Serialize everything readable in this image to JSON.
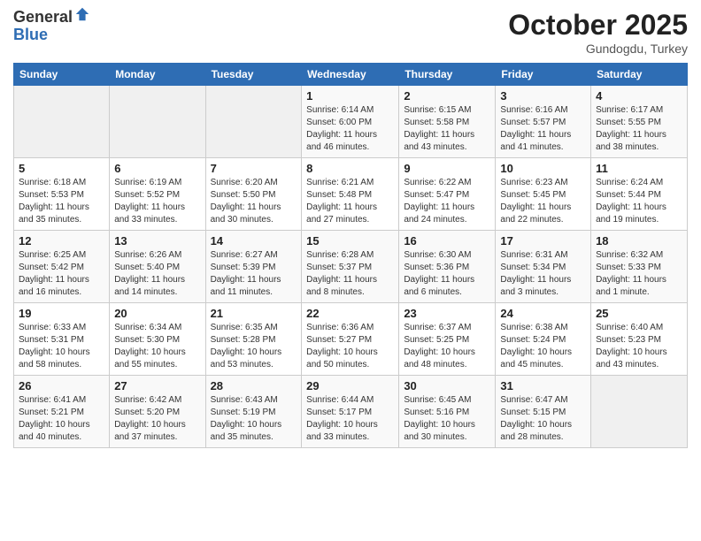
{
  "header": {
    "logo_line1": "General",
    "logo_line2": "Blue",
    "month": "October 2025",
    "location": "Gundogdu, Turkey"
  },
  "weekdays": [
    "Sunday",
    "Monday",
    "Tuesday",
    "Wednesday",
    "Thursday",
    "Friday",
    "Saturday"
  ],
  "weeks": [
    [
      {
        "day": "",
        "info": ""
      },
      {
        "day": "",
        "info": ""
      },
      {
        "day": "",
        "info": ""
      },
      {
        "day": "1",
        "info": "Sunrise: 6:14 AM\nSunset: 6:00 PM\nDaylight: 11 hours\nand 46 minutes."
      },
      {
        "day": "2",
        "info": "Sunrise: 6:15 AM\nSunset: 5:58 PM\nDaylight: 11 hours\nand 43 minutes."
      },
      {
        "day": "3",
        "info": "Sunrise: 6:16 AM\nSunset: 5:57 PM\nDaylight: 11 hours\nand 41 minutes."
      },
      {
        "day": "4",
        "info": "Sunrise: 6:17 AM\nSunset: 5:55 PM\nDaylight: 11 hours\nand 38 minutes."
      }
    ],
    [
      {
        "day": "5",
        "info": "Sunrise: 6:18 AM\nSunset: 5:53 PM\nDaylight: 11 hours\nand 35 minutes."
      },
      {
        "day": "6",
        "info": "Sunrise: 6:19 AM\nSunset: 5:52 PM\nDaylight: 11 hours\nand 33 minutes."
      },
      {
        "day": "7",
        "info": "Sunrise: 6:20 AM\nSunset: 5:50 PM\nDaylight: 11 hours\nand 30 minutes."
      },
      {
        "day": "8",
        "info": "Sunrise: 6:21 AM\nSunset: 5:48 PM\nDaylight: 11 hours\nand 27 minutes."
      },
      {
        "day": "9",
        "info": "Sunrise: 6:22 AM\nSunset: 5:47 PM\nDaylight: 11 hours\nand 24 minutes."
      },
      {
        "day": "10",
        "info": "Sunrise: 6:23 AM\nSunset: 5:45 PM\nDaylight: 11 hours\nand 22 minutes."
      },
      {
        "day": "11",
        "info": "Sunrise: 6:24 AM\nSunset: 5:44 PM\nDaylight: 11 hours\nand 19 minutes."
      }
    ],
    [
      {
        "day": "12",
        "info": "Sunrise: 6:25 AM\nSunset: 5:42 PM\nDaylight: 11 hours\nand 16 minutes."
      },
      {
        "day": "13",
        "info": "Sunrise: 6:26 AM\nSunset: 5:40 PM\nDaylight: 11 hours\nand 14 minutes."
      },
      {
        "day": "14",
        "info": "Sunrise: 6:27 AM\nSunset: 5:39 PM\nDaylight: 11 hours\nand 11 minutes."
      },
      {
        "day": "15",
        "info": "Sunrise: 6:28 AM\nSunset: 5:37 PM\nDaylight: 11 hours\nand 8 minutes."
      },
      {
        "day": "16",
        "info": "Sunrise: 6:30 AM\nSunset: 5:36 PM\nDaylight: 11 hours\nand 6 minutes."
      },
      {
        "day": "17",
        "info": "Sunrise: 6:31 AM\nSunset: 5:34 PM\nDaylight: 11 hours\nand 3 minutes."
      },
      {
        "day": "18",
        "info": "Sunrise: 6:32 AM\nSunset: 5:33 PM\nDaylight: 11 hours\nand 1 minute."
      }
    ],
    [
      {
        "day": "19",
        "info": "Sunrise: 6:33 AM\nSunset: 5:31 PM\nDaylight: 10 hours\nand 58 minutes."
      },
      {
        "day": "20",
        "info": "Sunrise: 6:34 AM\nSunset: 5:30 PM\nDaylight: 10 hours\nand 55 minutes."
      },
      {
        "day": "21",
        "info": "Sunrise: 6:35 AM\nSunset: 5:28 PM\nDaylight: 10 hours\nand 53 minutes."
      },
      {
        "day": "22",
        "info": "Sunrise: 6:36 AM\nSunset: 5:27 PM\nDaylight: 10 hours\nand 50 minutes."
      },
      {
        "day": "23",
        "info": "Sunrise: 6:37 AM\nSunset: 5:25 PM\nDaylight: 10 hours\nand 48 minutes."
      },
      {
        "day": "24",
        "info": "Sunrise: 6:38 AM\nSunset: 5:24 PM\nDaylight: 10 hours\nand 45 minutes."
      },
      {
        "day": "25",
        "info": "Sunrise: 6:40 AM\nSunset: 5:23 PM\nDaylight: 10 hours\nand 43 minutes."
      }
    ],
    [
      {
        "day": "26",
        "info": "Sunrise: 6:41 AM\nSunset: 5:21 PM\nDaylight: 10 hours\nand 40 minutes."
      },
      {
        "day": "27",
        "info": "Sunrise: 6:42 AM\nSunset: 5:20 PM\nDaylight: 10 hours\nand 37 minutes."
      },
      {
        "day": "28",
        "info": "Sunrise: 6:43 AM\nSunset: 5:19 PM\nDaylight: 10 hours\nand 35 minutes."
      },
      {
        "day": "29",
        "info": "Sunrise: 6:44 AM\nSunset: 5:17 PM\nDaylight: 10 hours\nand 33 minutes."
      },
      {
        "day": "30",
        "info": "Sunrise: 6:45 AM\nSunset: 5:16 PM\nDaylight: 10 hours\nand 30 minutes."
      },
      {
        "day": "31",
        "info": "Sunrise: 6:47 AM\nSunset: 5:15 PM\nDaylight: 10 hours\nand 28 minutes."
      },
      {
        "day": "",
        "info": ""
      }
    ]
  ]
}
